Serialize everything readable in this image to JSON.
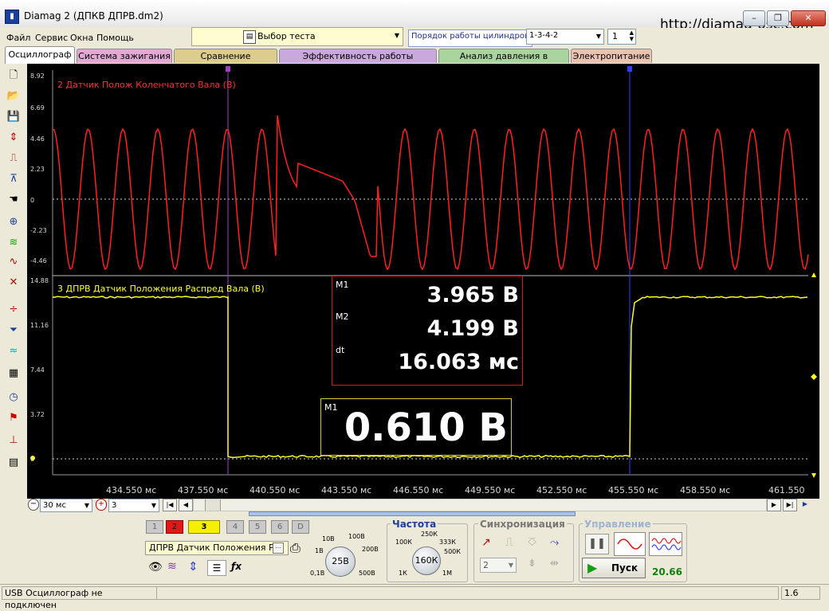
{
  "window": {
    "title": "Diamag 2 (ДПКВ ДПРВ.dm2)",
    "site_url": "http://diamag-osc.com",
    "minimize": "–",
    "maximize": "❐",
    "close": "✕"
  },
  "menu": [
    "Файл",
    "Сервис",
    "Окна",
    "Помощь"
  ],
  "toolbar": {
    "test_select": "Выбор теста",
    "cyl_order_label": "Порядок работы цилиндров",
    "cyl_order_value": "1-3-4-2",
    "cyl_number": "1"
  },
  "tabs": [
    {
      "label": "Осциллограф",
      "color": "#ffffff"
    },
    {
      "label": "Система зажигания",
      "color": "#e3a8d4"
    },
    {
      "label": "Сравнение цилиндров",
      "color": "#dccd8c"
    },
    {
      "label": "Эффективность работы цилиндров",
      "color": "#c9a8dd"
    },
    {
      "label": "Анализ давления в цилиндре",
      "color": "#a9d49e"
    },
    {
      "label": "Электропитание",
      "color": "#e9c2b2"
    }
  ],
  "plot": {
    "ch2": {
      "label": "2 Датчик Полож Коленчатого Вала (В)",
      "color": "#ff2020",
      "y_ticks": [
        "8.92",
        "6.69",
        "4.46",
        "2.23",
        "0",
        "-2.23",
        "-4.46"
      ]
    },
    "ch3": {
      "label": "3 ДПРВ Датчик Положения Распред Вала (В)",
      "color": "#ffff20",
      "y_ticks": [
        "14.88",
        "11.16",
        "7.44",
        "3.72",
        "0"
      ]
    },
    "x_ticks": [
      "434.550 мс",
      "437.550 мс",
      "440.550 мс",
      "443.550 мс",
      "446.550 мс",
      "449.550 мс",
      "452.550 мс",
      "455.550 мс",
      "458.550 мс",
      "461.550"
    ],
    "cursor1_label": "1",
    "cursor2_label": "2",
    "measurements": {
      "m1_label": "M1",
      "m1_value": "3.965 В",
      "m2_label": "M2",
      "m2_value": "4.199 В",
      "dt_label": "dt",
      "dt_value": "16.063 мс"
    },
    "marker": {
      "label": "M1",
      "value": "0.610 В"
    }
  },
  "scroll": {
    "timebase": "30 мс",
    "zoom_channel": "3"
  },
  "channels": {
    "buttons": [
      "1",
      "2",
      "3",
      "4",
      "5",
      "6",
      "D"
    ],
    "active_name": "ДПРВ Датчик Положения Рас",
    "more": "···"
  },
  "volt_knob": {
    "value": "25В",
    "scale": [
      "10В",
      "100В",
      "1В",
      "200В",
      "0,1В",
      "500В"
    ]
  },
  "freq": {
    "title": "Частота",
    "value": "160К",
    "scale": [
      "250К",
      "100К",
      "333К",
      "500К",
      "1К",
      "1М"
    ]
  },
  "sync": {
    "title": "Синхронизация",
    "value": "2"
  },
  "control": {
    "title": "Управление",
    "start": "Пуск",
    "rate": "20.66"
  },
  "status": {
    "left": "USB Осциллограф не подключен",
    "right": "1.6"
  }
}
